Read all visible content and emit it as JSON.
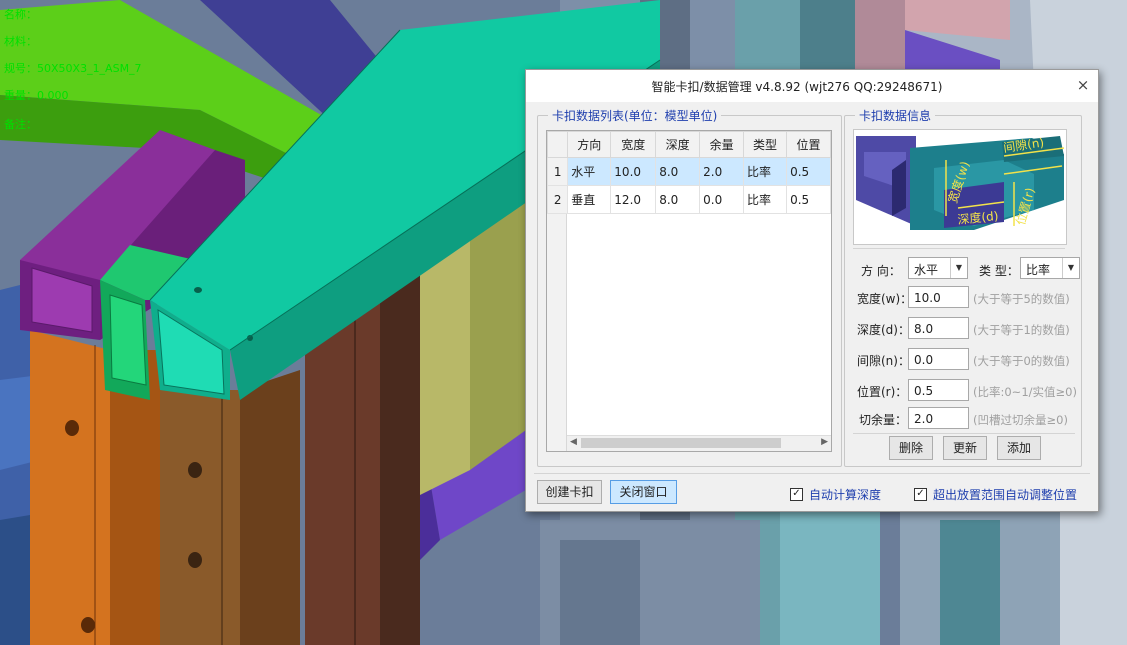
{
  "hud": {
    "name": "名称：",
    "material": "材料：",
    "spec": "规号：50X50X3_1_ASM_7",
    "weight": "重量：0.000",
    "note": "备注："
  },
  "dialog": {
    "title": "智能卡扣/数据管理 v4.8.92 (wjt276 QQ:29248671)",
    "close_glyph": "×",
    "list_group": {
      "legend": "卡扣数据列表(单位：模型单位)",
      "columns": [
        "方向",
        "宽度",
        "深度",
        "余量",
        "类型",
        "位置"
      ],
      "rows": [
        {
          "index": "1",
          "cells": [
            "水平",
            "10.0",
            "8.0",
            "2.0",
            "比率",
            "0.5"
          ],
          "selected": true
        },
        {
          "index": "2",
          "cells": [
            "垂直",
            "12.0",
            "8.0",
            "0.0",
            "比率",
            "0.5"
          ],
          "selected": false
        }
      ],
      "scroll_left": "◀",
      "scroll_right": "▶"
    },
    "info_group": {
      "legend": "卡扣数据信息",
      "image_labels": {
        "gap": "间隙(n)",
        "width": "宽度(w)",
        "depth": "深度(d)",
        "position": "位置(r)"
      },
      "direction_label": "方  向：",
      "direction_value": "水平",
      "type_label": "类 型：",
      "type_value": "比率",
      "width_label": "宽度(w)：",
      "width_value": "10.0",
      "width_hint": "(大于等于5的数值)",
      "depth_label": "深度(d)：",
      "depth_value": "8.0",
      "depth_hint": "(大于等于1的数值)",
      "gap_label": "间隙(n)：",
      "gap_value": "0.0",
      "gap_hint": "(大于等于0的数值)",
      "position_label": "位置(r)：",
      "position_value": "0.5",
      "position_hint": "(比率:0~1/实值≥0)",
      "margin_label": "切余量：",
      "margin_value": "2.0",
      "margin_hint": "(凹槽过切余量≥0)",
      "dropdown_glyph": "▼",
      "delete_label": "删除",
      "update_label": "更新",
      "add_label": "添加"
    },
    "footer": {
      "create_label": "创建卡扣",
      "close_label": "关闭窗口",
      "auto_depth_label": "自动计算深度",
      "auto_depth_checked": true,
      "auto_adjust_label": "超出放置范围自动调整位置",
      "auto_adjust_checked": true,
      "check_glyph": "✓"
    }
  }
}
